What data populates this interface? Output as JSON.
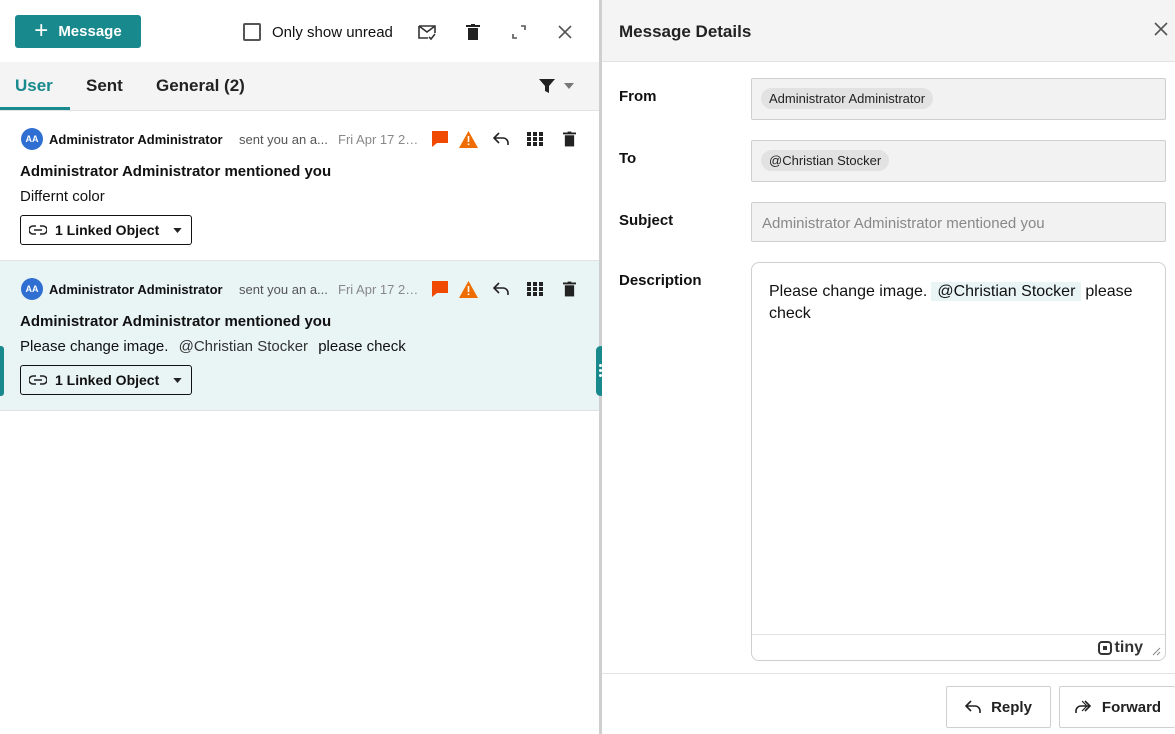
{
  "toolbar": {
    "new_message_label": "Message",
    "only_unread_label": "Only show unread"
  },
  "tabs": [
    {
      "label": "User",
      "active": true
    },
    {
      "label": "Sent",
      "active": false
    },
    {
      "label": "General (2)",
      "active": false
    }
  ],
  "messages": [
    {
      "avatar_initials": "AA",
      "from": "Administrator Administrator",
      "action": "sent you an a...",
      "date": "Fri Apr 17 202...",
      "title": "Administrator Administrator mentioned you",
      "body": "Differnt color",
      "body_mention": "",
      "body_after": "",
      "linked_label": "1 Linked Object",
      "selected": false
    },
    {
      "avatar_initials": "AA",
      "from": "Administrator Administrator",
      "action": "sent you an a...",
      "date": "Fri Apr 17 202...",
      "title": "Administrator Administrator mentioned you",
      "body": "Please change image.",
      "body_mention": "@Christian Stocker",
      "body_after": "please check",
      "linked_label": "1 Linked Object",
      "selected": true
    }
  ],
  "details": {
    "title": "Message Details",
    "from_label": "From",
    "from_value": "Administrator Administrator",
    "to_label": "To",
    "to_value": "@Christian Stocker",
    "subject_label": "Subject",
    "subject_value": "Administrator Administrator mentioned you",
    "description_label": "Description",
    "description_before": "Please change image.",
    "description_mention": "@Christian Stocker",
    "description_after": "please check",
    "editor_brand": "tiny",
    "reply_label": "Reply",
    "forward_label": "Forward"
  },
  "colors": {
    "accent": "#18898d",
    "comment_icon": "#f04a00",
    "warning_icon": "#ef6c00",
    "avatar": "#2f6fd1",
    "selected_row": "#e9f4f4"
  }
}
